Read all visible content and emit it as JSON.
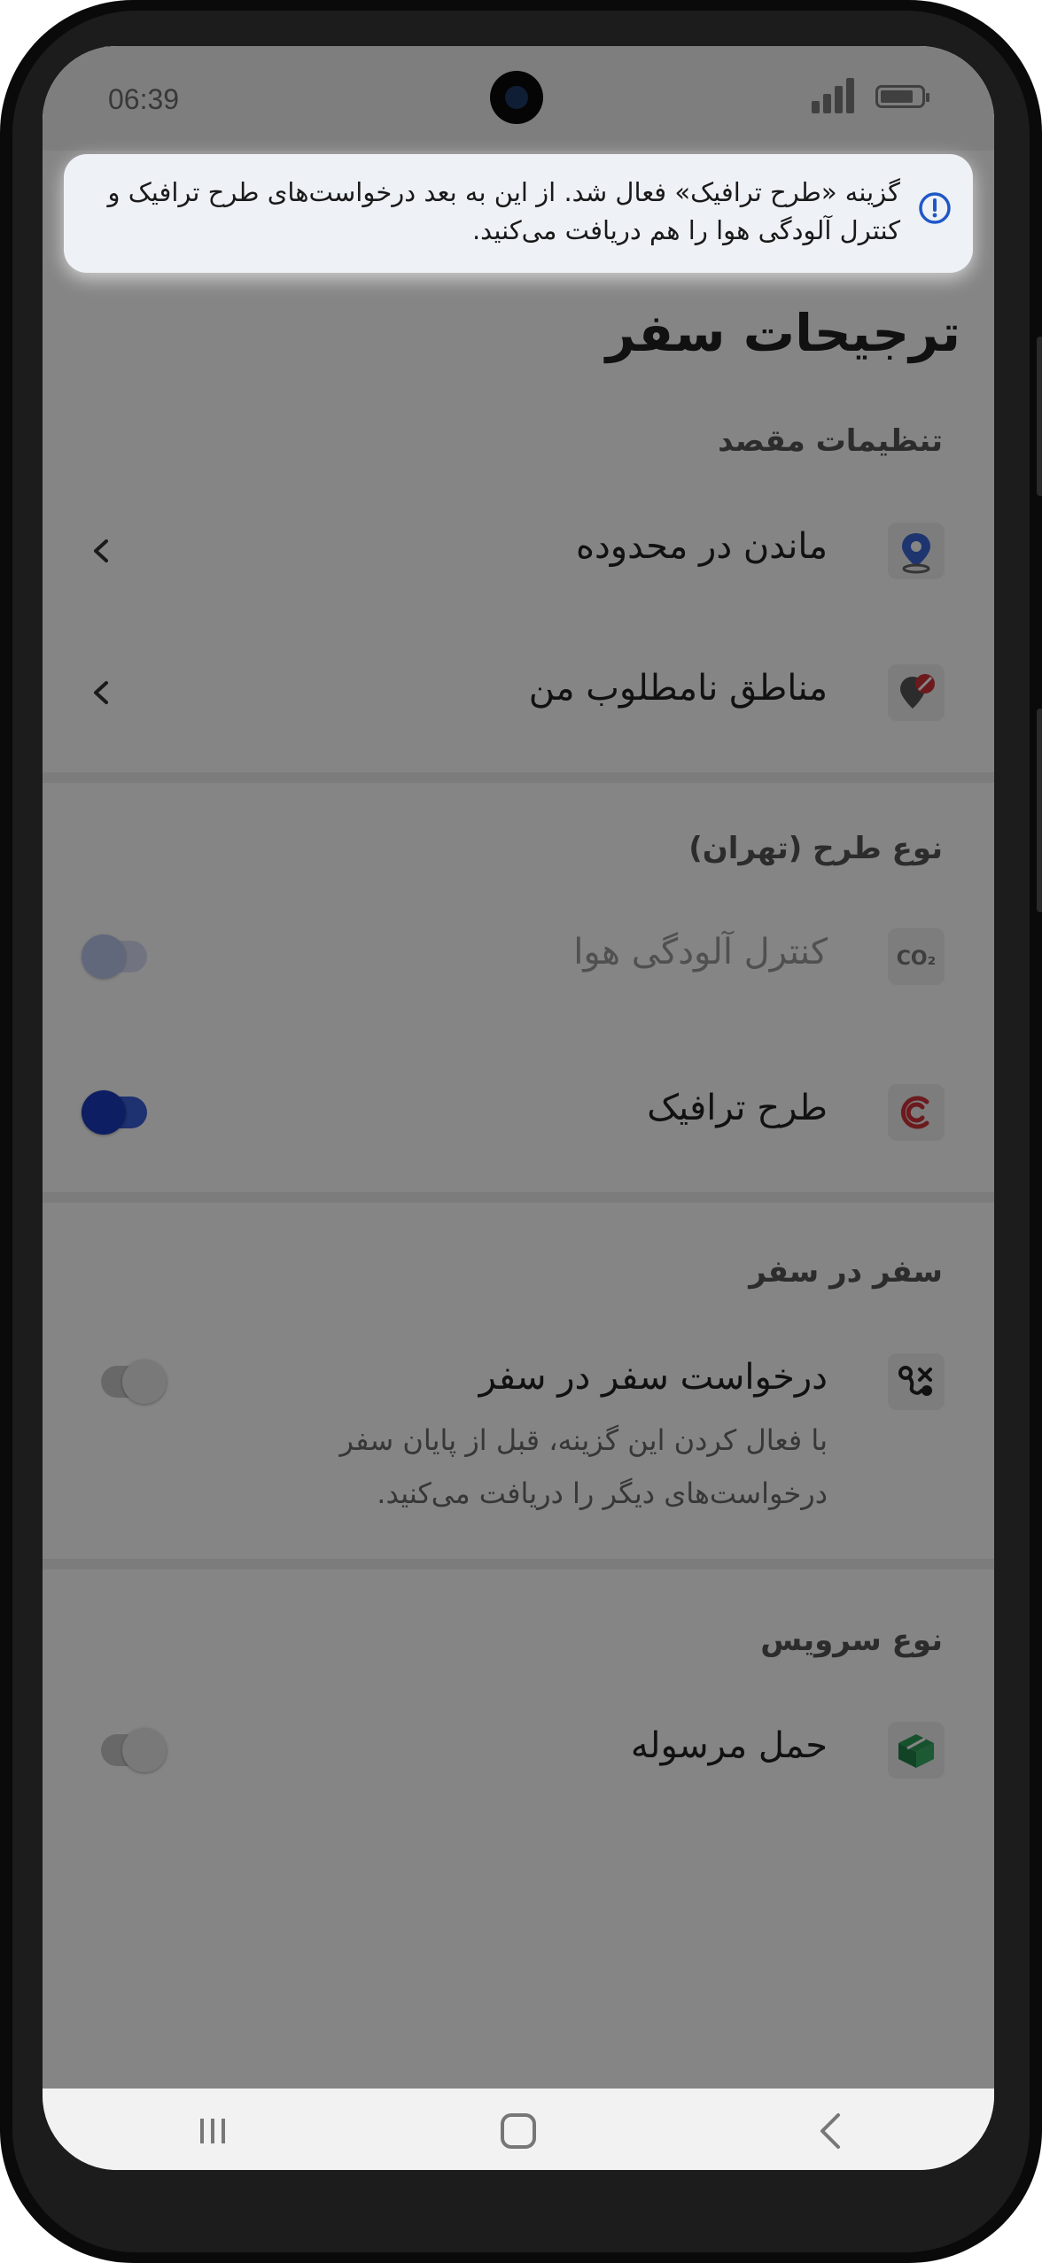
{
  "status_bar": {
    "time": "06:39"
  },
  "toast": {
    "message": "گزینه «طرح ترافیک» فعال شد. از این به بعد درخواست‌های طرح ترافیک و کنترل آلودگی هوا را هم دریافت می‌کنید."
  },
  "page": {
    "title": "ترجیحات سفر"
  },
  "sections": {
    "destination": {
      "title": "تنظیمات مقصد",
      "items": [
        {
          "label": "ماندن در محدوده",
          "icon": "location-pin-icon"
        },
        {
          "label": "مناطق نامطلوب من",
          "icon": "blocked-location-icon"
        }
      ]
    },
    "plan_type": {
      "title": "نوع طرح (تهران)",
      "items": [
        {
          "label": "کنترل آلودگی هوا",
          "icon": "co2-icon",
          "toggle_on": true,
          "disabled": true
        },
        {
          "label": "طرح ترافیک",
          "icon": "traffic-plan-icon",
          "toggle_on": true,
          "disabled": false
        }
      ]
    },
    "in_trip": {
      "title": "سفر در سفر",
      "items": [
        {
          "label": "درخواست سفر در سفر",
          "icon": "trip-route-icon",
          "toggle_on": false,
          "description": "با فعال کردن این گزینه، قبل از پایان سفر درخواست‌های دیگر را دریافت می‌کنید."
        }
      ]
    },
    "service_type": {
      "title": "نوع سرویس",
      "items": [
        {
          "label": "حمل مرسوله",
          "icon": "parcel-box-icon",
          "toggle_on": false
        }
      ]
    }
  },
  "nav_bar": {
    "buttons": [
      "recent-apps-icon",
      "home-icon",
      "back-icon"
    ]
  },
  "colors": {
    "accent": "#1b3bbf",
    "traffic_red": "#d0323a",
    "parcel_green": "#2e9b57",
    "pin_blue": "#3a66d6",
    "info_blue": "#1f57c7"
  }
}
